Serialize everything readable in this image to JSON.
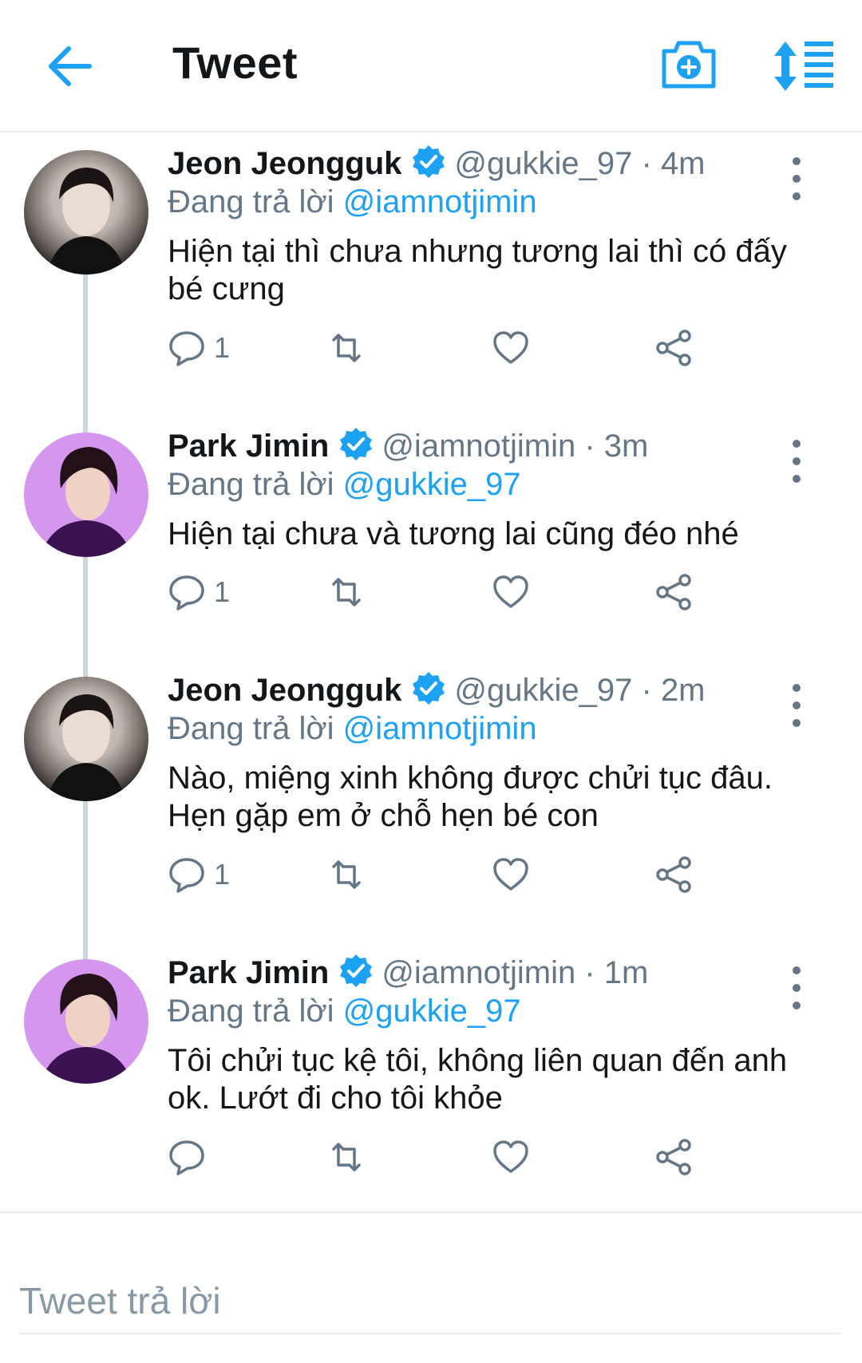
{
  "header": {
    "title": "Tweet",
    "icons": [
      "back-arrow-icon",
      "camera-plus-icon",
      "sort-toggle-icon"
    ],
    "accent": "#1da1f2"
  },
  "tweets": [
    {
      "name": "Jeon Jeongguk",
      "handle": "@gukkie_97",
      "dot": "·",
      "time": "4m",
      "replying_prefix": "Đang trả lời",
      "replying_to": "@iamnotjimin",
      "text": "Hiện tại thì chưa nhưng tương lai thì có đấy bé cưng",
      "reply_count": "1"
    },
    {
      "name": "Park Jimin",
      "handle": "@iamnotjimin",
      "dot": "·",
      "time": "3m",
      "replying_prefix": "Đang trả lời",
      "replying_to": "@gukkie_97",
      "text": "Hiện tại chưa và tương lai cũng đéo nhé",
      "reply_count": "1"
    },
    {
      "name": "Jeon Jeongguk",
      "handle": "@gukkie_97",
      "dot": "·",
      "time": "2m",
      "replying_prefix": "Đang trả lời",
      "replying_to": "@iamnotjimin",
      "text": "Nào, miệng xinh không được chửi tục đâu. Hẹn gặp em ở chỗ hẹn bé con",
      "reply_count": "1"
    },
    {
      "name": "Park Jimin",
      "handle": "@iamnotjimin",
      "dot": "·",
      "time": "1m",
      "replying_prefix": "Đang trả lời",
      "replying_to": "@gukkie_97",
      "text": "Tôi chửi tục kệ tôi, không liên quan đến anh ok. Lướt đi cho tôi khỏe",
      "reply_count": ""
    }
  ],
  "compose": {
    "placeholder": "Tweet trả lời"
  },
  "colors": {
    "accent": "#1da1f2",
    "secondary_text": "#657786",
    "primary_text": "#14171a",
    "divider": "#e6ecf0"
  }
}
